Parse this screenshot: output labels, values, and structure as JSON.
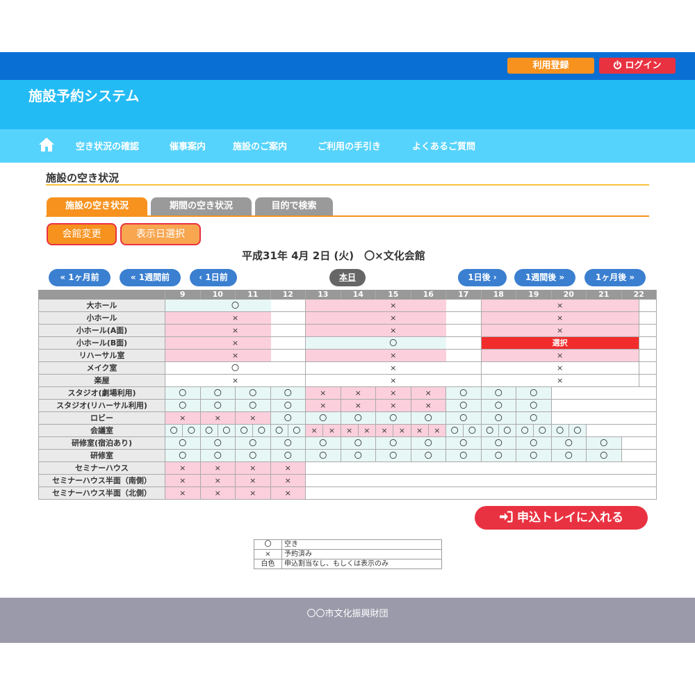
{
  "header": {
    "register_label": "利用登録",
    "login_label": "ログイン",
    "site_title": "施設予約システム"
  },
  "nav": {
    "items": [
      "空き状況の確認",
      "催事案内",
      "施設のご案内",
      "ご利用の手引き",
      "よくあるご質問"
    ]
  },
  "section": {
    "title": "施設の空き状況",
    "tabs": [
      "施設の空き状況",
      "期間の空き状況",
      "目的で検索"
    ],
    "change_hall_label": "会館変更",
    "select_date_label": "表示日選択",
    "date_heading": "平成31年 4月 2日 (火)　〇×文化会館"
  },
  "date_nav": {
    "prev_month": "1ヶ月前",
    "prev_week": "1週間前",
    "prev_day": "1日前",
    "today": "本日",
    "next_day": "1日後",
    "next_week": "1週間後",
    "next_month": "1ヶ月後"
  },
  "grid": {
    "hours": [
      "9",
      "10",
      "11",
      "12",
      "13",
      "14",
      "15",
      "16",
      "17",
      "18",
      "19",
      "20",
      "21",
      "22"
    ],
    "rooms": [
      {
        "name": "大ホール",
        "cells": [
          {
            "span": [
              0,
              3
            ],
            "state": "avail",
            "text": "〇"
          },
          {
            "span": [
              4,
              8
            ],
            "state": "booked",
            "text": "×"
          },
          {
            "span": [
              9,
              13.5
            ],
            "state": "booked",
            "text": "×"
          }
        ]
      },
      {
        "name": "小ホール",
        "cells": [
          {
            "span": [
              0,
              3
            ],
            "state": "booked",
            "text": "×"
          },
          {
            "span": [
              4,
              8
            ],
            "state": "booked",
            "text": "×"
          },
          {
            "span": [
              9,
              13.5
            ],
            "state": "booked",
            "text": "×"
          }
        ]
      },
      {
        "name": "小ホール(A面)",
        "cells": [
          {
            "span": [
              0,
              3
            ],
            "state": "booked",
            "text": "×"
          },
          {
            "span": [
              4,
              8
            ],
            "state": "booked",
            "text": "×"
          },
          {
            "span": [
              9,
              13.5
            ],
            "state": "booked",
            "text": "×"
          }
        ]
      },
      {
        "name": "小ホール(B面)",
        "cells": [
          {
            "span": [
              0,
              3
            ],
            "state": "booked",
            "text": "×"
          },
          {
            "span": [
              4,
              8
            ],
            "state": "avail",
            "text": "〇"
          },
          {
            "span": [
              9,
              13.5
            ],
            "state": "selected",
            "text": "選択"
          }
        ]
      },
      {
        "name": "リハーサル室",
        "cells": [
          {
            "span": [
              0,
              3
            ],
            "state": "booked",
            "text": "×"
          },
          {
            "span": [
              4,
              8
            ],
            "state": "booked",
            "text": "×"
          },
          {
            "span": [
              9,
              13.5
            ],
            "state": "booked",
            "text": "×"
          }
        ]
      },
      {
        "name": "メイク室",
        "cells": [
          {
            "span": [
              0,
              3
            ],
            "state": "white",
            "text": "〇"
          },
          {
            "span": [
              4,
              8
            ],
            "state": "white",
            "text": "×"
          },
          {
            "span": [
              9,
              13.5
            ],
            "state": "white",
            "text": "×"
          }
        ]
      },
      {
        "name": "楽屋",
        "cells": [
          {
            "span": [
              0,
              3
            ],
            "state": "white",
            "text": "×"
          },
          {
            "span": [
              4,
              8
            ],
            "state": "white",
            "text": "×"
          },
          {
            "span": [
              9,
              13.5
            ],
            "state": "white",
            "text": "×"
          }
        ]
      },
      {
        "name": "スタジオ(劇場利用)",
        "cells": [
          {
            "span": [
              0,
              2
            ],
            "state": "avail",
            "text": "〇"
          },
          {
            "span": [
              2,
              4
            ],
            "state": "avail",
            "text": "〇"
          },
          {
            "span": [
              4,
              6
            ],
            "state": "avail",
            "text": "〇"
          },
          {
            "span": [
              6,
              8
            ],
            "state": "avail",
            "text": "〇"
          },
          {
            "span": [
              8,
              10
            ],
            "state": "booked",
            "text": "×"
          },
          {
            "span": [
              10,
              12
            ],
            "state": "booked",
            "text": "×"
          },
          {
            "span": [
              12,
              14
            ],
            "state": "booked",
            "text": "×"
          },
          {
            "span": [
              14,
              16
            ],
            "state": "booked",
            "text": "×"
          },
          {
            "span": [
              16,
              18
            ],
            "state": "avail",
            "text": "〇"
          },
          {
            "span": [
              18,
              20
            ],
            "state": "avail",
            "text": "〇"
          },
          {
            "span": [
              20,
              22
            ],
            "state": "avail",
            "text": "〇"
          }
        ]
      },
      {
        "name": "スタジオ(リハーサル利用)",
        "cells": [
          {
            "span": [
              0,
              2
            ],
            "state": "avail",
            "text": "〇"
          },
          {
            "span": [
              2,
              4
            ],
            "state": "avail",
            "text": "〇"
          },
          {
            "span": [
              4,
              6
            ],
            "state": "avail",
            "text": "〇"
          },
          {
            "span": [
              6,
              8
            ],
            "state": "avail",
            "text": "〇"
          },
          {
            "span": [
              8,
              10
            ],
            "state": "booked",
            "text": "×"
          },
          {
            "span": [
              10,
              12
            ],
            "state": "booked",
            "text": "×"
          },
          {
            "span": [
              12,
              14
            ],
            "state": "booked",
            "text": "×"
          },
          {
            "span": [
              14,
              16
            ],
            "state": "booked",
            "text": "×"
          },
          {
            "span": [
              16,
              18
            ],
            "state": "avail",
            "text": "〇"
          },
          {
            "span": [
              18,
              20
            ],
            "state": "avail",
            "text": "〇"
          },
          {
            "span": [
              20,
              22
            ],
            "state": "avail",
            "text": "〇"
          }
        ]
      },
      {
        "name": "ロビー",
        "cells": [
          {
            "span": [
              0,
              2
            ],
            "state": "booked",
            "text": "×"
          },
          {
            "span": [
              2,
              4
            ],
            "state": "booked",
            "text": "×"
          },
          {
            "span": [
              4,
              6
            ],
            "state": "booked",
            "text": "×"
          },
          {
            "span": [
              6,
              8
            ],
            "state": "avail",
            "text": "〇"
          },
          {
            "span": [
              8,
              10
            ],
            "state": "avail",
            "text": "〇"
          },
          {
            "span": [
              10,
              12
            ],
            "state": "avail",
            "text": "〇"
          },
          {
            "span": [
              12,
              14
            ],
            "state": "avail",
            "text": "〇"
          },
          {
            "span": [
              14,
              16
            ],
            "state": "avail",
            "text": "〇"
          },
          {
            "span": [
              16,
              18
            ],
            "state": "avail",
            "text": "〇"
          },
          {
            "span": [
              18,
              20
            ],
            "state": "avail",
            "text": "〇"
          },
          {
            "span": [
              20,
              22
            ],
            "state": "avail",
            "text": "〇"
          }
        ]
      },
      {
        "name": "会議室",
        "cells": [
          {
            "span": [
              0,
              1
            ],
            "state": "avail",
            "text": "〇"
          },
          {
            "span": [
              1,
              2
            ],
            "state": "avail",
            "text": "〇"
          },
          {
            "span": [
              2,
              3
            ],
            "state": "avail",
            "text": "〇"
          },
          {
            "span": [
              3,
              4
            ],
            "state": "avail",
            "text": "〇"
          },
          {
            "span": [
              4,
              5
            ],
            "state": "avail",
            "text": "〇"
          },
          {
            "span": [
              5,
              6
            ],
            "state": "avail",
            "text": "〇"
          },
          {
            "span": [
              6,
              7
            ],
            "state": "avail",
            "text": "〇"
          },
          {
            "span": [
              7,
              8
            ],
            "state": "avail",
            "text": "〇"
          },
          {
            "span": [
              8,
              9
            ],
            "state": "booked",
            "text": "×"
          },
          {
            "span": [
              9,
              10
            ],
            "state": "booked",
            "text": "×"
          },
          {
            "span": [
              10,
              11
            ],
            "state": "booked",
            "text": "×"
          },
          {
            "span": [
              11,
              12
            ],
            "state": "booked",
            "text": "×"
          },
          {
            "span": [
              12,
              13
            ],
            "state": "booked",
            "text": "×"
          },
          {
            "span": [
              13,
              14
            ],
            "state": "booked",
            "text": "×"
          },
          {
            "span": [
              14,
              15
            ],
            "state": "booked",
            "text": "×"
          },
          {
            "span": [
              15,
              16
            ],
            "state": "booked",
            "text": "×"
          },
          {
            "span": [
              16,
              17
            ],
            "state": "avail",
            "text": "〇"
          },
          {
            "span": [
              17,
              18
            ],
            "state": "avail",
            "text": "〇"
          },
          {
            "span": [
              18,
              19
            ],
            "state": "avail",
            "text": "〇"
          },
          {
            "span": [
              19,
              20
            ],
            "state": "avail",
            "text": "〇"
          },
          {
            "span": [
              20,
              21
            ],
            "state": "avail",
            "text": "〇"
          },
          {
            "span": [
              21,
              22
            ],
            "state": "avail",
            "text": "〇"
          },
          {
            "span": [
              22,
              23
            ],
            "state": "avail",
            "text": "〇"
          },
          {
            "span": [
              23,
              24
            ],
            "state": "avail",
            "text": "〇"
          }
        ]
      },
      {
        "name": "研修室(宿泊あり)",
        "cells": [
          {
            "span": [
              0,
              2
            ],
            "state": "avail",
            "text": "〇"
          },
          {
            "span": [
              2,
              4
            ],
            "state": "avail",
            "text": "〇"
          },
          {
            "span": [
              4,
              6
            ],
            "state": "avail",
            "text": "〇"
          },
          {
            "span": [
              6,
              8
            ],
            "state": "avail",
            "text": "〇"
          },
          {
            "span": [
              8,
              10
            ],
            "state": "avail",
            "text": "〇"
          },
          {
            "span": [
              10,
              12
            ],
            "state": "avail",
            "text": "〇"
          },
          {
            "span": [
              12,
              14
            ],
            "state": "avail",
            "text": "〇"
          },
          {
            "span": [
              14,
              16
            ],
            "state": "avail",
            "text": "〇"
          },
          {
            "span": [
              16,
              18
            ],
            "state": "avail",
            "text": "〇"
          },
          {
            "span": [
              18,
              20
            ],
            "state": "avail",
            "text": "〇"
          },
          {
            "span": [
              20,
              22
            ],
            "state": "avail",
            "text": "〇"
          },
          {
            "span": [
              22,
              24
            ],
            "state": "avail",
            "text": "〇"
          },
          {
            "span": [
              24,
              26
            ],
            "state": "avail",
            "text": "〇"
          }
        ]
      },
      {
        "name": "研修室",
        "cells": [
          {
            "span": [
              0,
              2
            ],
            "state": "avail",
            "text": "〇"
          },
          {
            "span": [
              2,
              4
            ],
            "state": "avail",
            "text": "〇"
          },
          {
            "span": [
              4,
              6
            ],
            "state": "avail",
            "text": "〇"
          },
          {
            "span": [
              6,
              8
            ],
            "state": "avail",
            "text": "〇"
          },
          {
            "span": [
              8,
              10
            ],
            "state": "avail",
            "text": "〇"
          },
          {
            "span": [
              10,
              12
            ],
            "state": "avail",
            "text": "〇"
          },
          {
            "span": [
              12,
              14
            ],
            "state": "avail",
            "text": "〇"
          },
          {
            "span": [
              14,
              16
            ],
            "state": "avail",
            "text": "〇"
          },
          {
            "span": [
              16,
              18
            ],
            "state": "avail",
            "text": "〇"
          },
          {
            "span": [
              18,
              20
            ],
            "state": "avail",
            "text": "〇"
          },
          {
            "span": [
              20,
              22
            ],
            "state": "avail",
            "text": "〇"
          },
          {
            "span": [
              22,
              24
            ],
            "state": "avail",
            "text": "〇"
          },
          {
            "span": [
              24,
              26
            ],
            "state": "avail",
            "text": "〇"
          }
        ]
      },
      {
        "name": "セミナーハウス",
        "cells": [
          {
            "span": [
              0,
              2
            ],
            "state": "booked",
            "text": "×"
          },
          {
            "span": [
              2,
              4
            ],
            "state": "booked",
            "text": "×"
          },
          {
            "span": [
              4,
              6
            ],
            "state": "booked",
            "text": "×"
          },
          {
            "span": [
              6,
              8
            ],
            "state": "booked",
            "text": "×"
          }
        ]
      },
      {
        "name": "セミナーハウス半面（南側）",
        "cells": [
          {
            "span": [
              0,
              2
            ],
            "state": "booked",
            "text": "×"
          },
          {
            "span": [
              2,
              4
            ],
            "state": "booked",
            "text": "×"
          },
          {
            "span": [
              4,
              6
            ],
            "state": "booked",
            "text": "×"
          },
          {
            "span": [
              6,
              8
            ],
            "state": "booked",
            "text": "×"
          }
        ]
      },
      {
        "name": "セミナーハウス半面（北側）",
        "cells": [
          {
            "span": [
              0,
              2
            ],
            "state": "booked",
            "text": "×"
          },
          {
            "span": [
              2,
              4
            ],
            "state": "booked",
            "text": "×"
          },
          {
            "span": [
              4,
              6
            ],
            "state": "booked",
            "text": "×"
          },
          {
            "span": [
              6,
              8
            ],
            "state": "booked",
            "text": "×"
          }
        ]
      }
    ]
  },
  "tray_button_label": "申込トレイに入れる",
  "legend": [
    {
      "key": "〇",
      "desc": "空き"
    },
    {
      "key": "×",
      "desc": "予約済み"
    },
    {
      "key": "白色",
      "desc": "申込割当なし、もしくは表示のみ"
    }
  ],
  "footer_text": "〇〇市文化振興財団",
  "colors": {
    "topbar": "#0a6fd4",
    "brand": "#23bbf4",
    "nav": "#56d3fc",
    "accent_orange": "#f7921e",
    "accent_red": "#e93241",
    "available": "#e7f7f6",
    "booked": "#fccfdc",
    "selected": "#f22c2c"
  }
}
